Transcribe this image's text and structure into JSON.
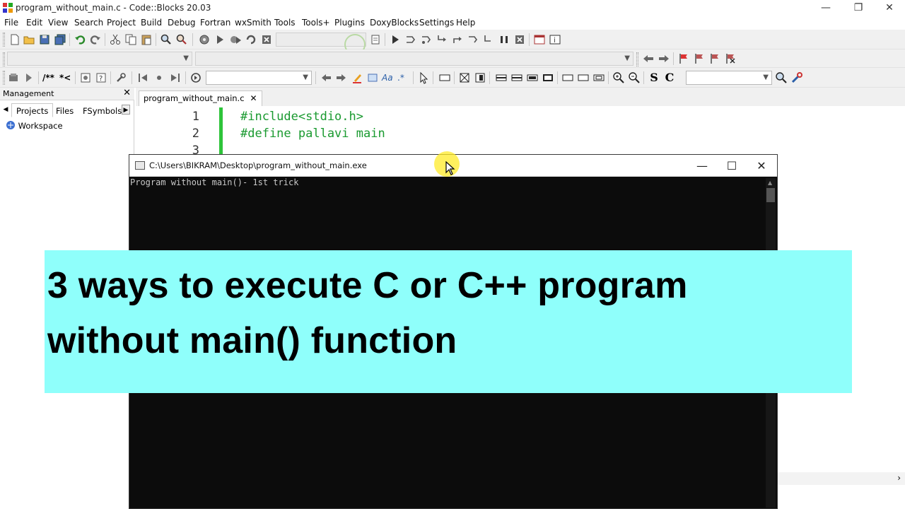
{
  "window": {
    "title": "program_without_main.c - Code::Blocks 20.03",
    "minimize_glyph": "—",
    "maximize_glyph": "❐",
    "close_glyph": "✕"
  },
  "menu": [
    "File",
    "Edit",
    "View",
    "Search",
    "Project",
    "Build",
    "Debug",
    "Fortran",
    "wxSmith",
    "Tools",
    "Tools+",
    "Plugins",
    "DoxyBlocks",
    "Settings",
    "Help"
  ],
  "toolbar": {
    "row1_icons": [
      "new-file-icon",
      "open-icon",
      "save-icon",
      "save-all-icon",
      "undo-icon",
      "redo-icon",
      "cut-icon",
      "copy-icon",
      "paste-icon",
      "find-icon",
      "replace-icon",
      "build-icon",
      "run-icon",
      "build-run-icon",
      "rebuild-icon",
      "abort-icon",
      "build-target-icon",
      "debug-icon",
      "run-to-cursor-icon",
      "next-line-icon",
      "step-into-icon",
      "step-out-icon",
      "next-instruction-icon",
      "step-into-instruction-icon",
      "break-debugger-icon",
      "stop-debugger-icon",
      "debug-windows-icon",
      "various-info-icon"
    ],
    "row2_icons": [
      "jump-back-icon",
      "jump-forward-icon",
      "toggle-bookmark-icon",
      "prev-bookmark-icon",
      "next-bookmark-icon",
      "clear-bookmarks-icon"
    ],
    "row3_icons": [
      "doxy-wizard-icon",
      "doxy-extract-icon",
      "block-comment-icon",
      "line-comment-icon",
      "run-html-icon",
      "run-chm-icon",
      "config-icon",
      "jump-prev-icon",
      "toggle-bp-icon",
      "jump-next-icon",
      "match-icon",
      "prev-icon",
      "next-icon",
      "highlight-icon",
      "select-icon",
      "replace-text-icon",
      "regex-icon",
      "pointer-icon",
      "rect-icon",
      "box-icon",
      "frame-icon",
      "zoom-in-icon",
      "zoom-out-icon",
      "s-icon",
      "c-icon",
      "search-icon",
      "tools-icon"
    ],
    "s_glyph": "S",
    "c_glyph": "C"
  },
  "management": {
    "title": "Management",
    "close": "✕",
    "tabs": [
      "Projects",
      "Files",
      "FSymbols"
    ],
    "active_tab": "Projects",
    "workspace": "Workspace"
  },
  "editor": {
    "tab_label": "program_without_main.c",
    "tab_close": "✕",
    "lines": [
      {
        "num": "1",
        "text": "#include<stdio.h>"
      },
      {
        "num": "2",
        "text": "#define pallavi main"
      },
      {
        "num": "3",
        "text": ""
      }
    ]
  },
  "console": {
    "title": "C:\\Users\\BIKRAM\\Desktop\\program_without_main.exe",
    "output": "Program without main()- 1st trick",
    "min": "—",
    "max": "☐",
    "close": "✕"
  },
  "banner": {
    "line1": "3 ways to execute C or C++ program",
    "line2": "without main() function",
    "background": "#8ffffb"
  },
  "colors": {
    "code": "#1a9a30",
    "console_bg": "#0c0c0c",
    "cursor_highlight": "#ffeb28"
  }
}
